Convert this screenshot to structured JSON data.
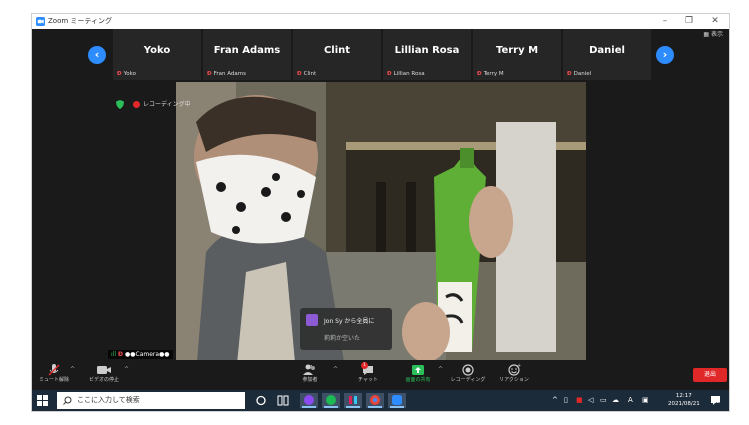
{
  "window": {
    "title": "Zoom ミーティング",
    "controls": {
      "minimize": "–",
      "restore": "❐",
      "close": "✕"
    }
  },
  "strip": {
    "prev_arrow": "‹",
    "next_arrow": "›",
    "view_toggle": "▦ 表示",
    "participants": [
      {
        "name": "Yoko",
        "label": "Yoko"
      },
      {
        "name": "Fran Adams",
        "label": "Fran Adams"
      },
      {
        "name": "Clint",
        "label": "Clint"
      },
      {
        "name": "Lillian Rosa",
        "label": "Lillian Rosa"
      },
      {
        "name": "Terry M",
        "label": "Terry M"
      },
      {
        "name": "Daniel",
        "label": "Daniel"
      }
    ],
    "mute_glyph": "Đ"
  },
  "indicators": {
    "recording_text": "レコーディング中"
  },
  "speaker": {
    "label": "●●Camera●●",
    "signal": "ıll"
  },
  "chat_notification": {
    "from": "Jon Sy から全員に",
    "message": "莉莉か空いた"
  },
  "toolbar": {
    "mute": "ミュート解除",
    "video": "ビデオの停止",
    "participants": "参加者",
    "participant_count": "67",
    "chat": "チャット",
    "chat_badge": "1",
    "share": "画面の共有",
    "record": "レコーディング",
    "reactions": "リアクション",
    "leave": "退出",
    "caret": "^"
  },
  "taskbar": {
    "search_placeholder": "ここに入力して検索",
    "tray_ime": "A",
    "clock_time": "12:17",
    "clock_date": "2021/08/21",
    "notification_count": "49"
  },
  "colors": {
    "accent_blue": "#2d8cff",
    "leave_red": "#e02828",
    "share_green": "#2bbf5a",
    "taskbar": "#1c2b3a"
  }
}
